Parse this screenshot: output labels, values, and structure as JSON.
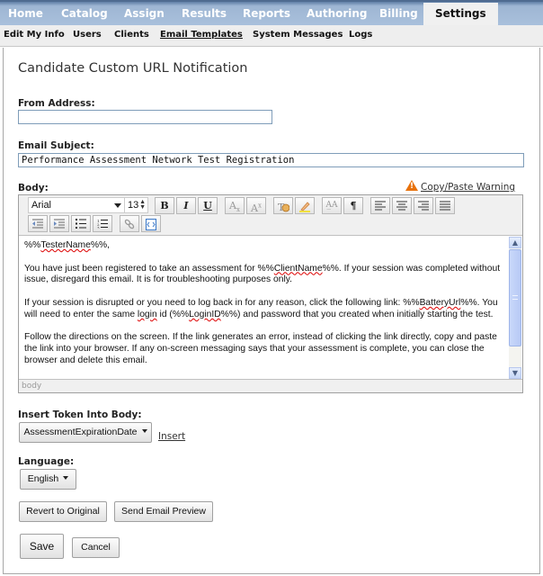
{
  "top_nav": {
    "tabs": [
      {
        "label": "Home",
        "active": false
      },
      {
        "label": "Catalog",
        "active": false
      },
      {
        "label": "Assign",
        "active": false
      },
      {
        "label": "Results",
        "active": false
      },
      {
        "label": "Reports",
        "active": false
      },
      {
        "label": "Authoring",
        "active": false
      },
      {
        "label": "Billing",
        "active": false
      },
      {
        "label": "Settings",
        "active": true
      }
    ]
  },
  "sub_nav": {
    "items": [
      {
        "label": "Edit My Info",
        "active": false
      },
      {
        "label": "Users",
        "active": false
      },
      {
        "label": "Clients",
        "active": false
      },
      {
        "label": "Email Templates",
        "active": true
      },
      {
        "label": "System Messages",
        "active": false
      },
      {
        "label": "Logs",
        "active": false
      }
    ]
  },
  "page": {
    "title": "Candidate Custom URL Notification"
  },
  "form": {
    "from_address": {
      "label": "From Address:",
      "value": ""
    },
    "email_subject": {
      "label": "Email Subject:",
      "value": "Performance Assessment Network Test Registration"
    },
    "body_label": "Body:",
    "copy_paste_warning": "Copy/Paste Warning",
    "editor": {
      "font": "Arial",
      "size": "13",
      "toolbar": {
        "bold": "B",
        "italic": "I",
        "underline": "U",
        "subscript": "Ax",
        "superscript": "Ax"
      },
      "paragraphs": [
        {
          "parts": [
            [
              "TesterName",
              true
            ]
          ],
          "pre": "%%",
          "post": "%%,"
        },
        {
          "text1": "You have just been registered to take an assessment for %%",
          "token": "ClientName",
          "text2": "%%. If your session was completed without issue, disregard this email. It is for troubleshooting purposes only."
        },
        {
          "text1": "If your session is disrupted or you need to log back in for any reason, click the following link: %%",
          "token": "BatteryUrl",
          "text2": "%%. You will need to enter the same ",
          "token2": "login",
          "text3": " id (%%",
          "token3": "LoginID",
          "text4": "%%) and password that you created when initially starting the test."
        },
        {
          "text": "Follow the directions on the screen. If the link generates an error, instead of clicking the link directly, copy and paste the link into your browser. If any on-screen messaging says that your assessment is complete, you can close the browser and delete this email."
        }
      ],
      "status_path": "body"
    },
    "insert_token": {
      "label": "Insert Token Into Body:",
      "selected": "AssessmentExpirationDate",
      "insert_link": "Insert"
    },
    "language": {
      "label": "Language:",
      "selected": "English"
    }
  },
  "buttons": {
    "revert": "Revert to Original",
    "send_preview": "Send Email Preview",
    "save": "Save",
    "cancel": "Cancel"
  },
  "colors": {
    "nav_bg": "#a9c0dc",
    "warning": "#e8720c",
    "input_border": "#7f9db9"
  }
}
